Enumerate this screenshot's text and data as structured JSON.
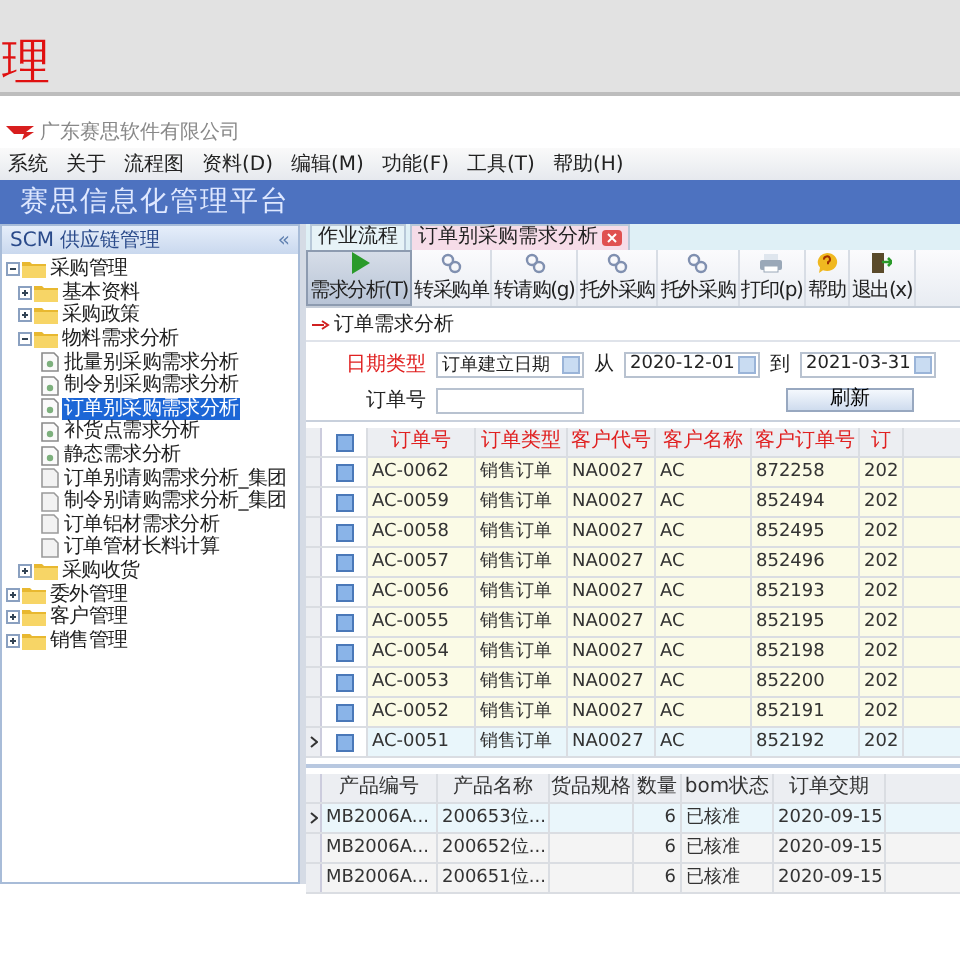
{
  "page_title": "理",
  "window": {
    "company": "广东赛思软件有限公司",
    "banner": "赛思信息化管理平台"
  },
  "menu": [
    "系统",
    "关于",
    "流程图",
    "资料(D)",
    "编辑(M)",
    "功能(F)",
    "工具(T)",
    "帮助(H)"
  ],
  "sidebar": {
    "title": "SCM 供应链管理",
    "collapse": "«",
    "tree": [
      {
        "label": "采购管理",
        "kind": "folder",
        "expanded": true,
        "selected": false,
        "children": [
          {
            "label": "基本资料",
            "kind": "folder",
            "expanded": false,
            "selected": false
          },
          {
            "label": "采购政策",
            "kind": "folder",
            "expanded": false,
            "selected": false
          },
          {
            "label": "物料需求分析",
            "kind": "folder",
            "expanded": true,
            "selected": false,
            "children": [
              {
                "label": "批量别采购需求分析",
                "kind": "report",
                "selected": false
              },
              {
                "label": "制令别采购需求分析",
                "kind": "report",
                "selected": false
              },
              {
                "label": "订单别采购需求分析",
                "kind": "report",
                "selected": true
              },
              {
                "label": "补货点需求分析",
                "kind": "report",
                "selected": false
              },
              {
                "label": "静态需求分析",
                "kind": "report",
                "selected": false
              },
              {
                "label": "订单别请购需求分析_集团",
                "kind": "page",
                "selected": false
              },
              {
                "label": "制令别请购需求分析_集团",
                "kind": "page",
                "selected": false
              },
              {
                "label": "订单铝材需求分析",
                "kind": "page",
                "selected": false
              },
              {
                "label": "订单管材长料计算",
                "kind": "page",
                "selected": false
              }
            ]
          },
          {
            "label": "采购收货",
            "kind": "folder",
            "expanded": false,
            "selected": false
          }
        ]
      },
      {
        "label": "委外管理",
        "kind": "folder",
        "expanded": false,
        "selected": false
      },
      {
        "label": "客户管理",
        "kind": "folder",
        "expanded": false,
        "selected": false
      },
      {
        "label": "销售管理",
        "kind": "folder",
        "expanded": false,
        "selected": false
      }
    ]
  },
  "tabs": [
    {
      "label": "作业流程",
      "selected": false,
      "closable": false
    },
    {
      "label": "订单别采购需求分析",
      "selected": true,
      "closable": true
    }
  ],
  "toolbar": [
    {
      "label": "需求分析(T)",
      "kind": "play",
      "selected": true
    },
    {
      "label": "转采购单",
      "kind": "gears",
      "selected": false
    },
    {
      "label": "转请购(g)",
      "kind": "gears",
      "selected": false
    },
    {
      "label": "托外采购",
      "kind": "gears",
      "selected": false
    },
    {
      "label": "托外采购",
      "kind": "gears",
      "selected": false
    },
    {
      "label": "打印(p)",
      "kind": "print",
      "selected": false
    },
    {
      "label": "帮助",
      "kind": "help",
      "selected": false
    },
    {
      "label": "退出(x)",
      "kind": "exit",
      "selected": false
    }
  ],
  "section_title": "订单需求分析",
  "form": {
    "date_type_label": "日期类型",
    "date_type": "订单建立日期",
    "from_label": "从",
    "from": "2020-12-01",
    "to_label": "到",
    "to": "2021-03-31",
    "order_label": "订单号",
    "refresh": "刷新"
  },
  "table": {
    "all_checked": true,
    "columns": [
      "订单号",
      "订单类型",
      "客户代号",
      "客户名称",
      "客户订单号",
      "订"
    ],
    "rows": [
      {
        "checked": true,
        "selected": false,
        "cells": [
          "AC-0062",
          "销售订单",
          "NA0027",
          "AC",
          "872258",
          "202"
        ]
      },
      {
        "checked": true,
        "selected": false,
        "cells": [
          "AC-0059",
          "销售订单",
          "NA0027",
          "AC",
          "852494",
          "202"
        ]
      },
      {
        "checked": true,
        "selected": false,
        "cells": [
          "AC-0058",
          "销售订单",
          "NA0027",
          "AC",
          "852495",
          "202"
        ]
      },
      {
        "checked": true,
        "selected": false,
        "cells": [
          "AC-0057",
          "销售订单",
          "NA0027",
          "AC",
          "852496",
          "202"
        ]
      },
      {
        "checked": true,
        "selected": false,
        "cells": [
          "AC-0056",
          "销售订单",
          "NA0027",
          "AC",
          "852193",
          "202"
        ]
      },
      {
        "checked": true,
        "selected": false,
        "cells": [
          "AC-0055",
          "销售订单",
          "NA0027",
          "AC",
          "852195",
          "202"
        ]
      },
      {
        "checked": true,
        "selected": false,
        "cells": [
          "AC-0054",
          "销售订单",
          "NA0027",
          "AC",
          "852198",
          "202"
        ]
      },
      {
        "checked": true,
        "selected": false,
        "cells": [
          "AC-0053",
          "销售订单",
          "NA0027",
          "AC",
          "852200",
          "202"
        ]
      },
      {
        "checked": true,
        "selected": false,
        "cells": [
          "AC-0052",
          "销售订单",
          "NA0027",
          "AC",
          "852191",
          "202"
        ]
      },
      {
        "checked": true,
        "selected": true,
        "cells": [
          "AC-0051",
          "销售订单",
          "NA0027",
          "AC",
          "852192",
          "202"
        ]
      }
    ]
  },
  "detail_table": {
    "columns": [
      "产品编号",
      "产品名称",
      "货品规格",
      "数量",
      "bom状态",
      "订单交期"
    ],
    "rows": [
      {
        "selected": true,
        "cells": [
          "MB2006A...",
          "200653位...",
          null,
          "6",
          "已核准",
          "2020-09-15"
        ]
      },
      {
        "selected": false,
        "cells": [
          "MB2006A...",
          "200652位...",
          null,
          "6",
          "已核准",
          "2020-09-15"
        ]
      },
      {
        "selected": false,
        "cells": [
          "MB2006A...",
          "200651位...",
          null,
          "6",
          "已核准",
          "2020-09-15"
        ]
      }
    ]
  }
}
